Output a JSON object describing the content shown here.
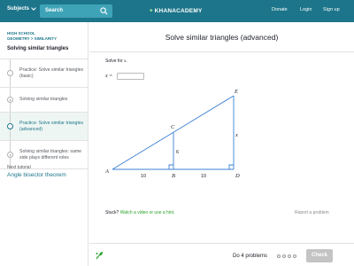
{
  "topbar": {
    "subjects_label": "Subjects",
    "search_placeholder": "Search",
    "logo_text": "KHANACADEMY",
    "donate": "Donate",
    "login": "Login",
    "signup": "Sign up"
  },
  "sidebar": {
    "breadcrumb_line1": "HIGH SCHOOL",
    "breadcrumb_line2": "GEOMETRY > SIMILARITY",
    "tutorial_title": "Solving similar triangles",
    "items": [
      {
        "label": "Practice: Solve similar triangles (basic)"
      },
      {
        "label": "Solving similar triangles"
      },
      {
        "label": "Practice: Solve similar triangles (advanced)"
      },
      {
        "label": "Solving similar triangles: same side plays different roles"
      }
    ],
    "next_label": "Next tutorial",
    "next_link": "Angle bisector theorem"
  },
  "main": {
    "title": "Solve similar triangles (advanced)",
    "prompt_text": "Solve for",
    "prompt_var": "x",
    "prompt_end": ".",
    "answer_label": "x =",
    "answer_value": "",
    "figure": {
      "points": {
        "A": "A",
        "B": "B",
        "C": "C",
        "D": "D",
        "E": "E"
      },
      "label_ab": "10",
      "label_bd": "10",
      "label_bc": "6",
      "label_de": "x"
    },
    "stuck_text": "Stuck?",
    "hint_text": "Watch a video or use a hint.",
    "report_text": "Report a problem",
    "do_problems": "Do 4 problems",
    "check_label": "Check"
  },
  "colors": {
    "topbar": "#1c758a",
    "accent": "#1c758a",
    "hint_green": "#29a329",
    "figure_blue": "#3b7fd4"
  }
}
